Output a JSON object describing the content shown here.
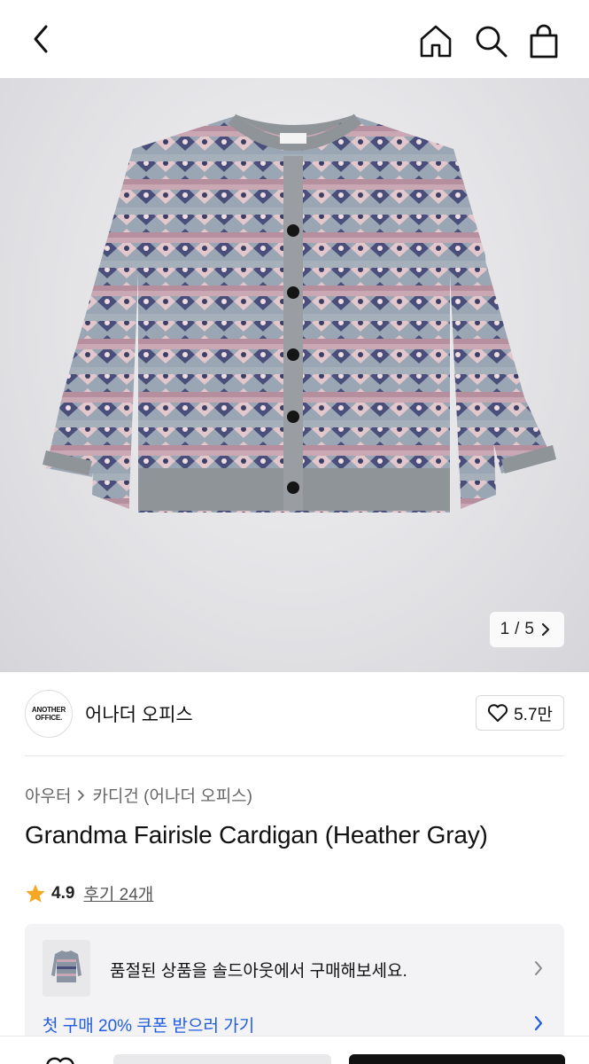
{
  "header": {
    "back_icon": "chevron-left-icon",
    "home_icon": "home-icon",
    "search_icon": "search-icon",
    "cart_icon": "shopping-bag-icon"
  },
  "gallery": {
    "current": "1",
    "separator": "/",
    "total": "5",
    "next_icon": "chevron-right-icon"
  },
  "brand": {
    "logo_line1": "ANOTHER",
    "logo_line2": "OFFICE.",
    "name": "어나더 오피스",
    "like_icon": "heart-outline-icon",
    "like_count": "5.7만"
  },
  "breadcrumb": {
    "category": "아우터",
    "separator_icon": "chevron-right-icon",
    "subcategory": "카디건 (어나더 오피스)"
  },
  "product": {
    "title": "Grandma Fairisle Cardigan (Heather Gray)",
    "rating_icon": "star-icon",
    "rating": "4.9",
    "reviews": "후기 24개"
  },
  "promo": {
    "text": "품절된 상품을 솔드아웃에서 구매해보세요.",
    "coupon_link": "첫 구매 20% 쿠폰 받으러 가기"
  },
  "colors": {
    "star": "#f5a623",
    "link": "#1f5ce0",
    "primary_button": "#111111"
  }
}
